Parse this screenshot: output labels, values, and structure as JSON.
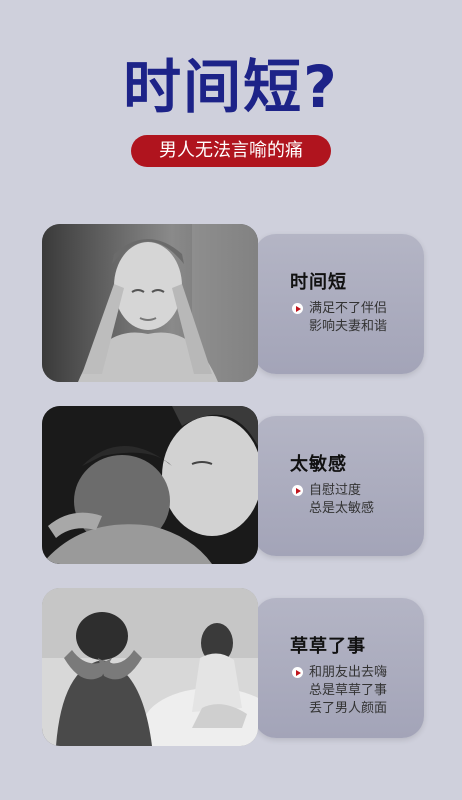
{
  "header": {
    "title": "时间短?",
    "subtitle": "男人无法言喻的痛"
  },
  "cards": [
    {
      "title": "时间短",
      "lines": [
        "满足不了伴侣",
        "影响夫妻和谐"
      ]
    },
    {
      "title": "太敏感",
      "lines": [
        "自慰过度",
        "总是太敏感"
      ]
    },
    {
      "title": "草草了事",
      "lines": [
        "和朋友出去嗨",
        "总是草草了事",
        "丢了男人颜面"
      ]
    }
  ],
  "colors": {
    "title": "#1d2388",
    "pill": "#b0141e",
    "background": "#cfd0dc"
  }
}
